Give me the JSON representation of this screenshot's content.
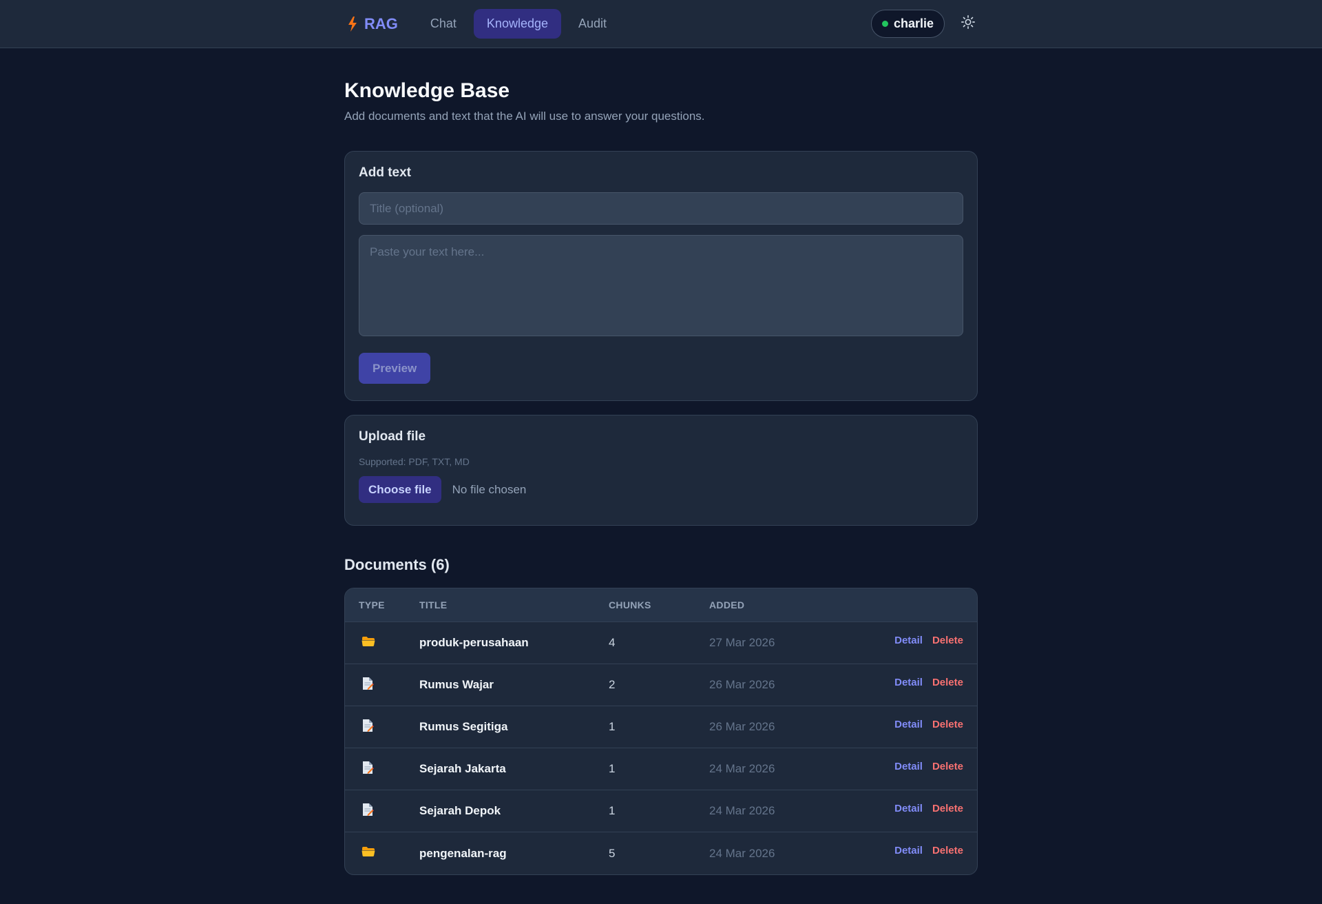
{
  "header": {
    "brand": "RAG",
    "tabs": [
      {
        "label": "Chat",
        "active": false
      },
      {
        "label": "Knowledge",
        "active": true
      },
      {
        "label": "Audit",
        "active": false
      }
    ],
    "user": "charlie",
    "user_status_color": "#22c55e",
    "theme_icon": "sun-icon"
  },
  "page": {
    "title": "Knowledge Base",
    "subtitle": "Add documents and text that the AI will use to answer your questions."
  },
  "add_text": {
    "heading": "Add text",
    "title_placeholder": "Title (optional)",
    "title_value": "",
    "text_placeholder": "Paste your text here...",
    "text_value": "",
    "preview_label": "Preview"
  },
  "upload": {
    "heading": "Upload file",
    "supported": "Supported: PDF, TXT, MD",
    "choose_label": "Choose file",
    "file_status": "No file chosen"
  },
  "documents": {
    "heading": "Documents (6)",
    "columns": {
      "type": "TYPE",
      "title": "TITLE",
      "chunks": "CHUNKS",
      "added": "ADDED"
    },
    "detail_label": "Detail",
    "delete_label": "Delete",
    "rows": [
      {
        "type_icon": "folder-icon",
        "title": "produk-perusahaan",
        "chunks": "4",
        "added": "27 Mar 2026"
      },
      {
        "type_icon": "document-icon",
        "title": "Rumus Wajar",
        "chunks": "2",
        "added": "26 Mar 2026"
      },
      {
        "type_icon": "document-icon",
        "title": "Rumus Segitiga",
        "chunks": "1",
        "added": "26 Mar 2026"
      },
      {
        "type_icon": "document-icon",
        "title": "Sejarah Jakarta",
        "chunks": "1",
        "added": "24 Mar 2026"
      },
      {
        "type_icon": "document-icon",
        "title": "Sejarah Depok",
        "chunks": "1",
        "added": "24 Mar 2026"
      },
      {
        "type_icon": "folder-icon",
        "title": "pengenalan-rag",
        "chunks": "5",
        "added": "24 Mar 2026"
      }
    ]
  },
  "colors": {
    "background": "#0f172a",
    "surface": "#1e293b",
    "accent": "#818cf8",
    "danger": "#f87171",
    "brand_icon": "#f97316"
  }
}
